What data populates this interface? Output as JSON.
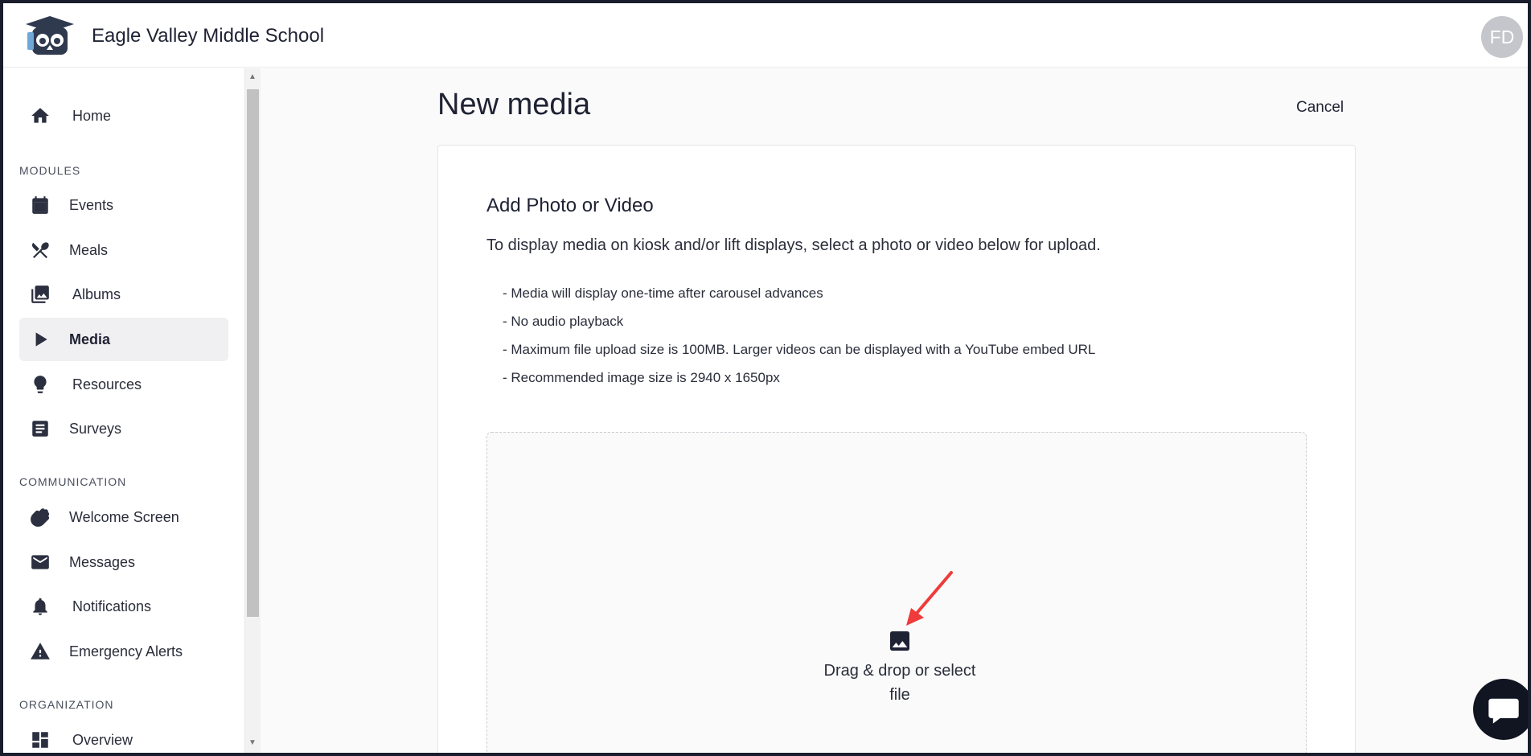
{
  "header": {
    "school_name": "Eagle Valley Middle School",
    "avatar_initials": "FD"
  },
  "sidebar": {
    "home": {
      "label": "Home",
      "icon": "home-icon"
    },
    "sections": {
      "modules": "MODULES",
      "communication": "COMMUNICATION",
      "organization": "ORGANIZATION"
    },
    "modules": [
      {
        "label": "Events",
        "icon": "calendar-icon"
      },
      {
        "label": "Meals",
        "icon": "utensils-icon"
      },
      {
        "label": "Albums",
        "icon": "photo-library-icon"
      },
      {
        "label": "Media",
        "icon": "play-icon",
        "active": true
      },
      {
        "label": "Resources",
        "icon": "lightbulb-icon"
      },
      {
        "label": "Surveys",
        "icon": "survey-icon"
      }
    ],
    "communication": [
      {
        "label": "Welcome Screen",
        "icon": "waving-hand-icon"
      },
      {
        "label": "Messages",
        "icon": "mail-icon"
      },
      {
        "label": "Notifications",
        "icon": "bell-icon"
      },
      {
        "label": "Emergency Alerts",
        "icon": "warning-icon"
      }
    ],
    "organization": [
      {
        "label": "Overview",
        "icon": "dashboard-icon"
      }
    ]
  },
  "main": {
    "title": "New media",
    "cancel_label": "Cancel",
    "card": {
      "title": "Add Photo or Video",
      "description": "To display media on kiosk and/or lift displays, select a photo or video below for upload.",
      "bullets": [
        "- Media will display one-time after carousel advances",
        "- No audio playback",
        "- Maximum file upload size is 100MB. Larger videos can be displayed with a YouTube embed URL",
        "- Recommended image size is 2940 x 1650px"
      ],
      "dropzone_text": "Drag & drop or select file"
    }
  },
  "colors": {
    "accent_dark": "#1e2233",
    "annotation_arrow": "#ef3b3b",
    "active_item_bg": "#f0f0f2"
  }
}
